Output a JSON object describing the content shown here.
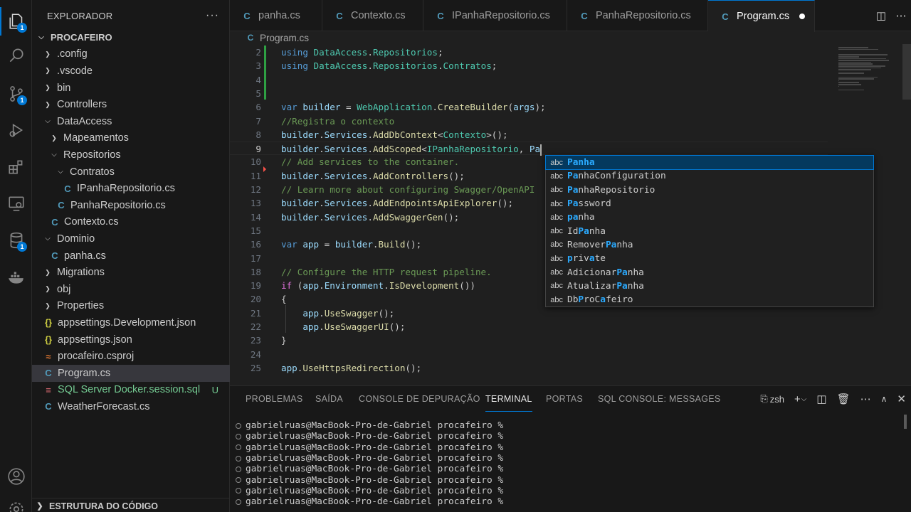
{
  "activity_bar": {
    "icons": [
      {
        "name": "explorer-icon",
        "badge": "1"
      },
      {
        "name": "search-icon",
        "badge": ""
      },
      {
        "name": "source-control-icon",
        "badge": "1"
      },
      {
        "name": "run-debug-icon",
        "badge": ""
      },
      {
        "name": "extensions-icon",
        "badge": ""
      },
      {
        "name": "remote-explorer-icon",
        "badge": ""
      },
      {
        "name": "database-icon",
        "badge": "1"
      },
      {
        "name": "docker-icon",
        "badge": ""
      },
      {
        "name": "accounts-icon",
        "badge": ""
      },
      {
        "name": "manage-gear-icon",
        "badge": ""
      }
    ]
  },
  "sidebar": {
    "title": "EXPLORADOR",
    "more": "···",
    "root": "PROCAFEIRO",
    "items": [
      {
        "label": ".config",
        "type": "folder",
        "open": false,
        "depth": 1
      },
      {
        "label": ".vscode",
        "type": "folder",
        "open": false,
        "depth": 1
      },
      {
        "label": "bin",
        "type": "folder",
        "open": false,
        "depth": 1
      },
      {
        "label": "Controllers",
        "type": "folder",
        "open": false,
        "depth": 1
      },
      {
        "label": "DataAccess",
        "type": "folder",
        "open": true,
        "depth": 1
      },
      {
        "label": "Mapeamentos",
        "type": "folder",
        "open": false,
        "depth": 2
      },
      {
        "label": "Repositorios",
        "type": "folder",
        "open": true,
        "depth": 2
      },
      {
        "label": "Contratos",
        "type": "folder",
        "open": true,
        "depth": 3
      },
      {
        "label": "IPanhaRepositorio.cs",
        "type": "cs",
        "depth": 4
      },
      {
        "label": "PanhaRepositorio.cs",
        "type": "cs",
        "depth": 3
      },
      {
        "label": "Contexto.cs",
        "type": "cs",
        "depth": 2
      },
      {
        "label": "Dominio",
        "type": "folder",
        "open": true,
        "depth": 1
      },
      {
        "label": "panha.cs",
        "type": "cs",
        "depth": 2
      },
      {
        "label": "Migrations",
        "type": "folder",
        "open": false,
        "depth": 1
      },
      {
        "label": "obj",
        "type": "folder",
        "open": false,
        "depth": 1
      },
      {
        "label": "Properties",
        "type": "folder",
        "open": false,
        "depth": 1
      },
      {
        "label": "appsettings.Development.json",
        "type": "json",
        "depth": 1
      },
      {
        "label": "appsettings.json",
        "type": "json",
        "depth": 1
      },
      {
        "label": "procafeiro.csproj",
        "type": "rss",
        "depth": 1
      },
      {
        "label": "Program.cs",
        "type": "cs",
        "depth": 1,
        "selected": true
      },
      {
        "label": "SQL Server Docker.session.sql",
        "type": "sql",
        "depth": 1,
        "status": "U"
      },
      {
        "label": "WeatherForecast.cs",
        "type": "cs",
        "depth": 1
      }
    ],
    "outline": "ESTRUTURA DO CÓDIGO"
  },
  "tabs": [
    {
      "label": "panha.cs"
    },
    {
      "label": "Contexto.cs"
    },
    {
      "label": "IPanhaRepositorio.cs"
    },
    {
      "label": "PanhaRepositorio.cs"
    },
    {
      "label": "Program.cs",
      "active": true,
      "dirty": true
    }
  ],
  "breadcrumb": {
    "file": "Program.cs"
  },
  "editor": {
    "lines": [
      {
        "n": "2",
        "html": "<span class='k'>using</span> <span class='t'>DataAccess</span>.<span class='t'>Repositorios</span>;"
      },
      {
        "n": "3",
        "html": "<span class='k'>using</span> <span class='t'>DataAccess</span>.<span class='t'>Repositorios</span>.<span class='t'>Contratos</span>;"
      },
      {
        "n": "4",
        "html": ""
      },
      {
        "n": "5",
        "html": ""
      },
      {
        "n": "6",
        "html": "<span class='k'>var</span> <span class='v'>builder</span> = <span class='t'>WebApplication</span>.<span class='f'>CreateBuilder</span>(<span class='v'>args</span>);"
      },
      {
        "n": "7",
        "html": "<span class='c'>//Registra o contexto</span>"
      },
      {
        "n": "8",
        "html": "<span class='v'>builder</span>.<span class='v'>Services</span>.<span class='f'>AddDbContext</span>&lt;<span class='t'>Contexto</span>&gt;();"
      },
      {
        "n": "9",
        "html": "<span class='v'>builder</span>.<span class='v'>Services</span>.<span class='f'>AddScoped</span>&lt;<span class='t'>IPanhaRepositorio</span>, <span class='v'>Pa</span><span class='cursor'></span>",
        "current": true
      },
      {
        "n": "10",
        "html": "<span class='c'>// Add services to the container.</span>"
      },
      {
        "n": "11",
        "html": "<span class='v'>builder</span>.<span class='v'>Services</span>.<span class='f'>AddControllers</span>();"
      },
      {
        "n": "12",
        "html": "<span class='c'>// Learn more about configuring Swagger/OpenAPI</span>"
      },
      {
        "n": "13",
        "html": "<span class='v'>builder</span>.<span class='v'>Services</span>.<span class='f'>AddEndpointsApiExplorer</span>();"
      },
      {
        "n": "14",
        "html": "<span class='v'>builder</span>.<span class='v'>Services</span>.<span class='f'>AddSwaggerGen</span>();"
      },
      {
        "n": "15",
        "html": ""
      },
      {
        "n": "16",
        "html": "<span class='k'>var</span> <span class='v'>app</span> = <span class='v'>builder</span>.<span class='f'>Build</span>();"
      },
      {
        "n": "17",
        "html": ""
      },
      {
        "n": "18",
        "html": "<span class='c'>// Configure the HTTP request pipeline.</span>"
      },
      {
        "n": "19",
        "html": "<span class='br'>if</span> (<span class='v'>app</span>.<span class='v'>Environment</span>.<span class='f'>IsDevelopment</span>())"
      },
      {
        "n": "20",
        "html": "{"
      },
      {
        "n": "21",
        "html": "    <span class='v'>app</span>.<span class='f'>UseSwagger</span>();"
      },
      {
        "n": "22",
        "html": "    <span class='v'>app</span>.<span class='f'>UseSwaggerUI</span>();"
      },
      {
        "n": "23",
        "html": "}"
      },
      {
        "n": "24",
        "html": ""
      },
      {
        "n": "25",
        "html": "<span class='v'>app</span>.<span class='f'>UseHttpsRedirection</span>();"
      }
    ]
  },
  "suggest": {
    "kind": "abc",
    "items": [
      {
        "pre": "",
        "hl": "Panha",
        "post": "",
        "selected": true
      },
      {
        "pre": "",
        "hl": "Pa",
        "post": "nhaConfiguration"
      },
      {
        "pre": "",
        "hl": "Pa",
        "post": "nhaRepositorio"
      },
      {
        "pre": "",
        "hl": "Pa",
        "post": "ssword"
      },
      {
        "pre": "",
        "hl": "pa",
        "post": "nha"
      },
      {
        "pre": "Id",
        "hl": "Pa",
        "post": "nha"
      },
      {
        "pre": "Remover",
        "hl": "Pa",
        "post": "nha"
      },
      {
        "pre": "",
        "hl": "p",
        "post": "riv",
        "hl2": "a",
        "post2": "te"
      },
      {
        "pre": "Adicionar",
        "hl": "Pa",
        "post": "nha"
      },
      {
        "pre": "Atualizar",
        "hl": "Pa",
        "post": "nha"
      },
      {
        "pre": "Db",
        "hl": "P",
        "post": "roC",
        "hl2": "a",
        "post2": "feiro"
      }
    ]
  },
  "panel": {
    "tabs": [
      "PROBLEMAS",
      "SAÍDA",
      "CONSOLE DE DEPURAÇÃO",
      "TERMINAL",
      "PORTAS",
      "SQL CONSOLE: MESSAGES"
    ],
    "active_tab": "TERMINAL",
    "shell": "zsh",
    "terminal_lines": [
      "gabrielruas@MacBook-Pro-de-Gabriel procafeiro %",
      "gabrielruas@MacBook-Pro-de-Gabriel procafeiro %",
      "gabrielruas@MacBook-Pro-de-Gabriel procafeiro %",
      "gabrielruas@MacBook-Pro-de-Gabriel procafeiro %",
      "gabrielruas@MacBook-Pro-de-Gabriel procafeiro %",
      "gabrielruas@MacBook-Pro-de-Gabriel procafeiro %",
      "gabrielruas@MacBook-Pro-de-Gabriel procafeiro %",
      "gabrielruas@MacBook-Pro-de-Gabriel procafeiro %"
    ]
  }
}
